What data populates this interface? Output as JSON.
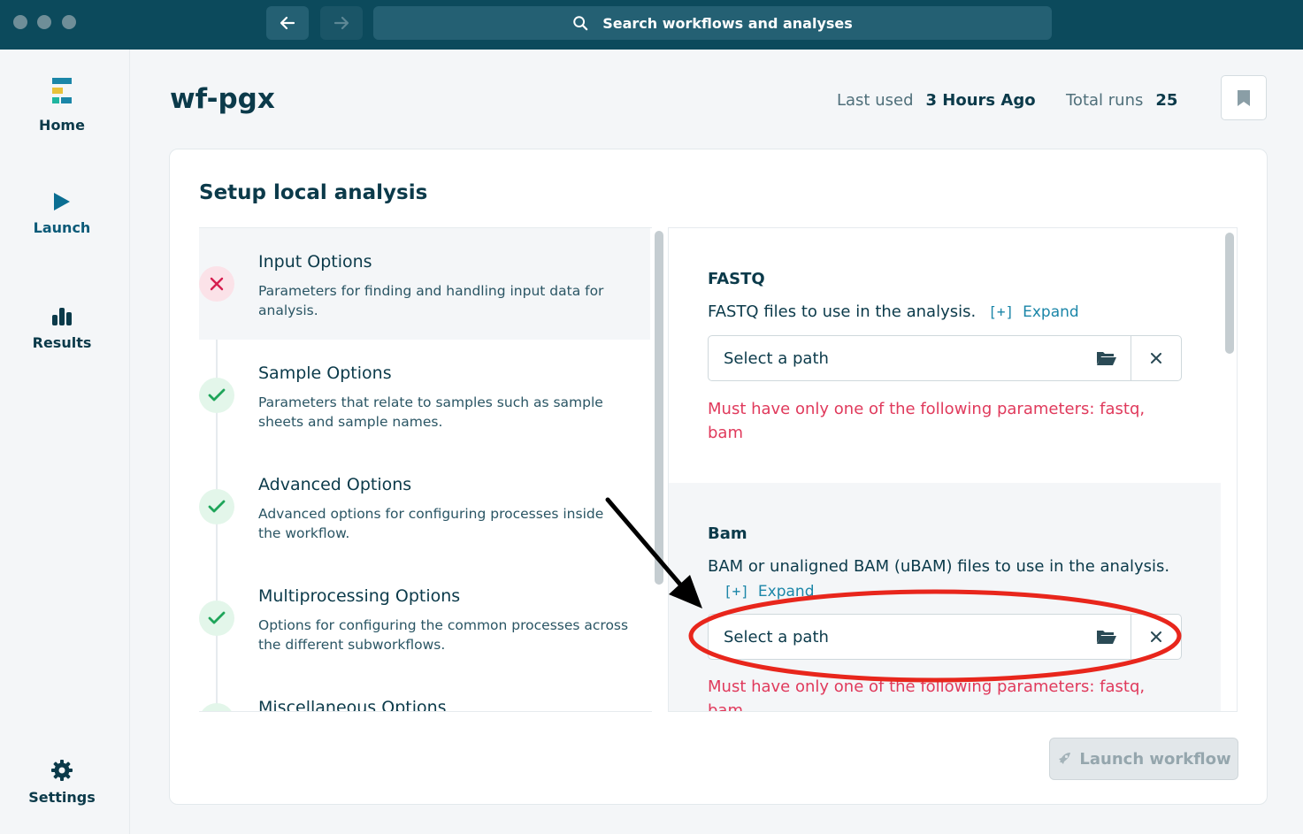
{
  "titlebar": {
    "search_placeholder": "Search workflows and analyses",
    "icons": [
      "arrow-left-icon",
      "arrow-right-icon",
      "search-icon"
    ]
  },
  "sidebar": {
    "items": [
      {
        "label": "Home",
        "icon": "epi2me-logo-icon"
      },
      {
        "label": "Launch",
        "icon": "play-icon"
      },
      {
        "label": "Results",
        "icon": "bar-chart-icon"
      },
      {
        "label": "Settings",
        "icon": "gear-icon"
      }
    ]
  },
  "header": {
    "title": "wf-pgx",
    "last_used_label": "Last used",
    "last_used_value": "3 Hours Ago",
    "total_runs_label": "Total runs",
    "total_runs_value": "25"
  },
  "card": {
    "title": "Setup local analysis",
    "steps": [
      {
        "title": "Input Options",
        "desc": "Parameters for finding and handling input data for analysis.",
        "status": "error"
      },
      {
        "title": "Sample Options",
        "desc": "Parameters that relate to samples such as sample sheets and sample names.",
        "status": "ok"
      },
      {
        "title": "Advanced Options",
        "desc": "Advanced options for configuring processes inside the workflow.",
        "status": "ok"
      },
      {
        "title": "Multiprocessing Options",
        "desc": "Options for configuring the common processes across the different subworkflows.",
        "status": "ok"
      },
      {
        "title": "Miscellaneous Options",
        "desc": "",
        "status": "ok"
      }
    ],
    "params": [
      {
        "name": "FASTQ",
        "desc": "FASTQ files to use in the analysis.",
        "expand_bracket": "[+]",
        "expand_label": "Expand",
        "placeholder": "Select a path",
        "error": "Must have only one of the following parameters: fastq, bam"
      },
      {
        "name": "Bam",
        "desc": "BAM or unaligned BAM (uBAM) files to use in the analysis.",
        "expand_bracket": "[+]",
        "expand_label": "Expand",
        "placeholder": "Select a path",
        "error": "Must have only one of the following parameters: fastq, bam"
      }
    ],
    "launch_label": "Launch workflow"
  },
  "colors": {
    "titlebar": "#0c4a5c",
    "accent": "#1b86a8",
    "error": "#e03a5c",
    "success": "#1fa55a",
    "annotation_circle": "#e8261c"
  }
}
